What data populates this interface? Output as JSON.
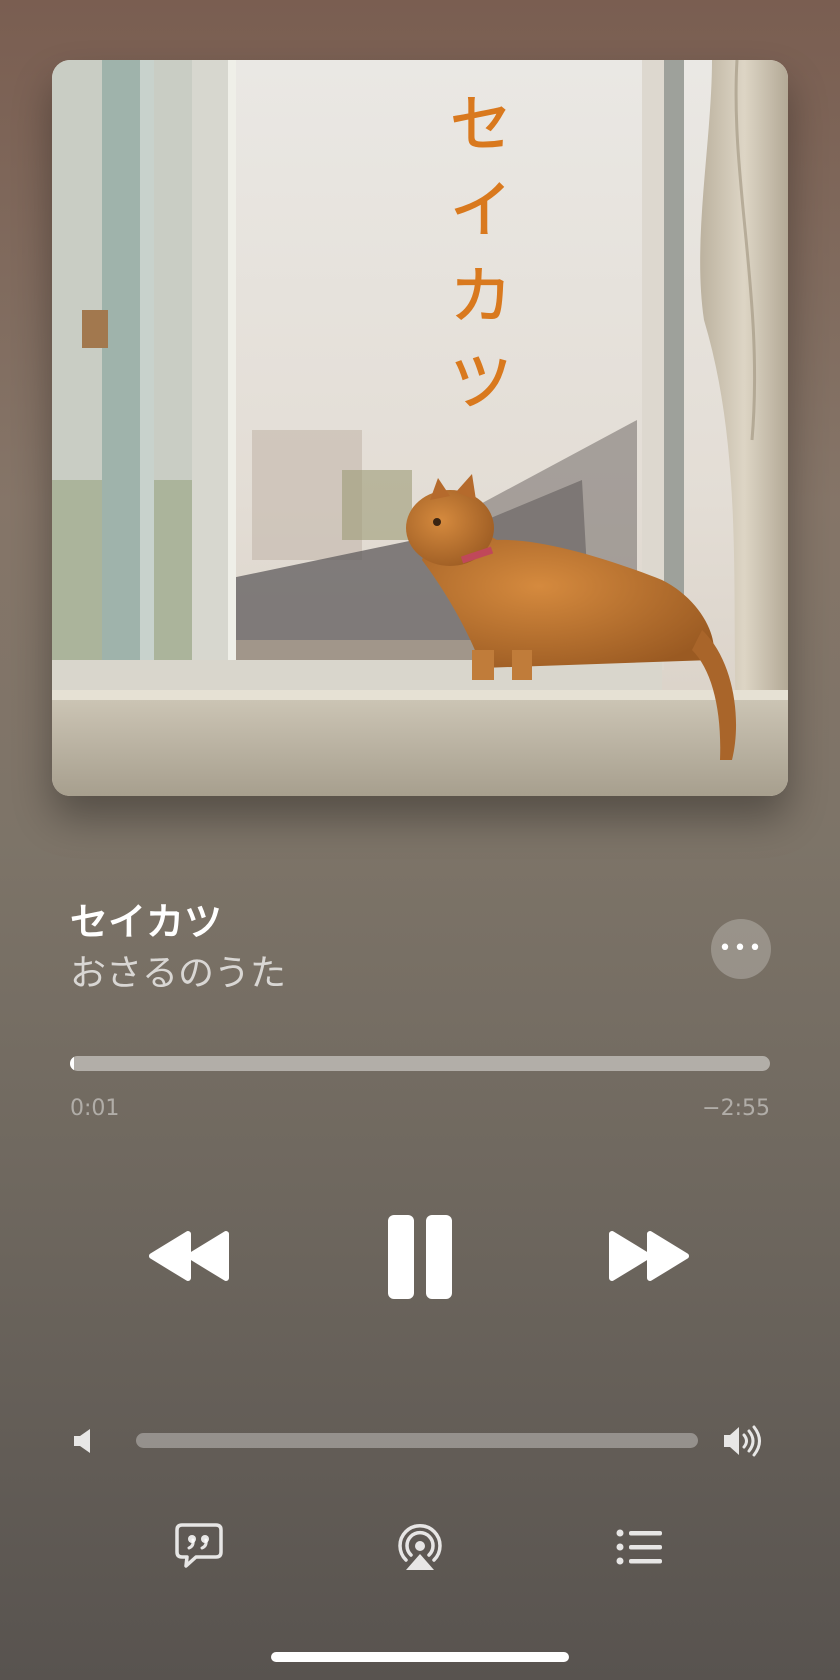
{
  "artwork": {
    "title_text": "セイカツ"
  },
  "track": {
    "title": "セイカツ",
    "artist": "おさるのうた"
  },
  "more_button": {
    "icon": "ellipsis-icon",
    "label": "•••"
  },
  "playback": {
    "elapsed": "0:01",
    "remaining": "−2:55",
    "progress_fraction": 0.006
  },
  "controls": {
    "previous_icon": "backward-icon",
    "play_pause_icon": "pause-icon",
    "next_icon": "forward-icon"
  },
  "volume": {
    "low_icon": "speaker-low-icon",
    "high_icon": "speaker-high-icon",
    "level_fraction": 0.0
  },
  "bottom_bar": {
    "lyrics_icon": "lyrics-icon",
    "airplay_icon": "airplay-icon",
    "queue_icon": "queue-list-icon"
  },
  "colors": {
    "art_title": "#d9791e",
    "background_top": "#7a5e51",
    "background_bottom": "#58534f"
  }
}
